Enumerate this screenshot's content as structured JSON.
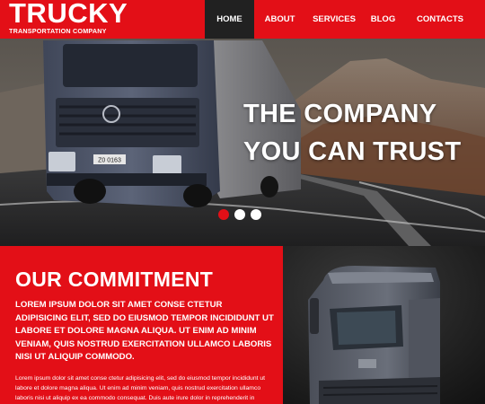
{
  "brand": {
    "name": "TRUCKY",
    "tagline": "TRANSPORTATION COMPANY"
  },
  "nav": [
    {
      "label": "HOME",
      "active": true
    },
    {
      "label": "ABOUT",
      "active": false
    },
    {
      "label": "SERVICES",
      "active": false
    },
    {
      "label": "BLOG",
      "active": false
    },
    {
      "label": "CONTACTS",
      "active": false
    }
  ],
  "hero": {
    "line1": "THE COMPANY",
    "line2": "YOU CAN TRUST",
    "plate": "Z0 0163",
    "slides": 3,
    "active_slide": 1
  },
  "commitment": {
    "title": "OUR COMMITMENT",
    "lead": "LOREM IPSUM DOLOR SIT AMET CONSE CTETUR ADIPISICING ELIT, SED DO EIUSMOD TEMPOR INCIDIDUNT UT LABORE ET DOLORE MAGNA ALIQUA. UT ENIM AD MINIM VENIAM, QUIS NOSTRUD EXERCITATION ULLAMCO LABORIS NISI UT ALIQUIP COMMODO.",
    "body": "Lorem ipsum dolor sit amet conse ctetur adipisicing elit, sed do eiusmod tempor incididunt ut labore et dolore magna aliqua. Ut enim ad minim veniam, quis nostrud exercitation ullamco laboris nisi ut aliquip ex ea commodo consequat. Duis aute irure dolor in reprehenderit in"
  },
  "colors": {
    "brand_red": "#e30f17",
    "nav_active_bg": "#212121",
    "text": "#ffffff"
  }
}
